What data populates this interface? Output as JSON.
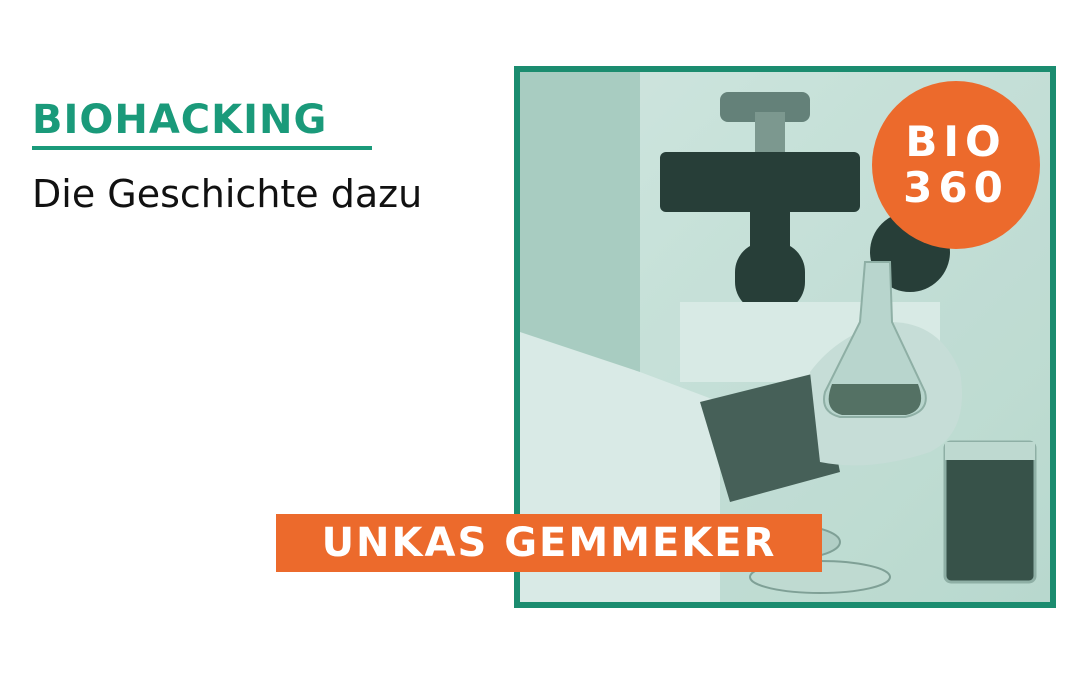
{
  "category": "BIOHACKING",
  "subtitle": "Die Geschichte dazu",
  "badge": {
    "line1": "BIO",
    "line2": "360"
  },
  "author": "UNKAS GEMMEKER",
  "colors": {
    "green": "#1b8c6f",
    "green_text": "#1a9a7a",
    "orange": "#ec6a2c"
  }
}
